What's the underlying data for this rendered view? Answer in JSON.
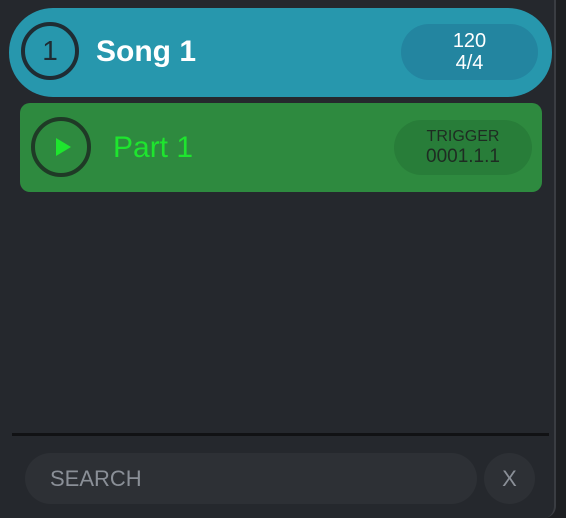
{
  "song": {
    "number": "1",
    "title": "Song 1",
    "tempo": "120",
    "time_signature": "4/4",
    "color": "#2797ad"
  },
  "part": {
    "title": "Part 1",
    "play_icon": "play-icon",
    "trigger_label": "TRIGGER",
    "trigger_value": "0001.1.1",
    "color": "#2e8a3f",
    "text_color": "#1ee52e"
  },
  "search": {
    "placeholder": "SEARCH",
    "clear_label": "X"
  }
}
